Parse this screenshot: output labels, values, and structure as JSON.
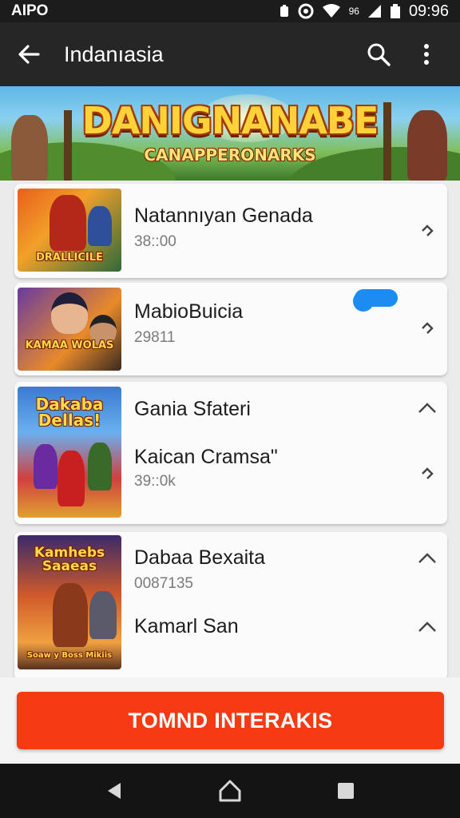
{
  "status_bar": {
    "carrier": "AIPO",
    "time": "09:96",
    "network_label": "96"
  },
  "app_bar": {
    "title": "Indanıasia"
  },
  "banner": {
    "title": "DANIGNANABE",
    "subtitle": "CANAPPERONARKS"
  },
  "list": {
    "items": [
      {
        "title": "Natannıyan Genada",
        "subtitle": "38::00",
        "thumb_label": "DRALLICILE",
        "icon": "chevron-right-icon"
      },
      {
        "title": "MabioBuicia",
        "subtitle": "29811",
        "thumb_label": "KAMAA WOLAS",
        "icon": "chevron-right-icon"
      },
      {
        "title": "Gania Sfateri",
        "subtitle": "",
        "thumb_label": "Dakaba Dellas!",
        "icon": "chevron-up-icon"
      },
      {
        "title": "Kaican Cramsa\"",
        "subtitle": "39::0k",
        "thumb_label": "",
        "icon": "chevron-right-icon"
      },
      {
        "title": "Dabaa Bexaita",
        "subtitle": "0087135",
        "thumb_label": "Kamhebs Saaeas",
        "thumb_footer": "Soaw y Boss Mikiis",
        "icon": "chevron-up-icon"
      },
      {
        "title": "Kamarl San",
        "subtitle": "",
        "thumb_label": "",
        "icon": "chevron-up-icon"
      }
    ]
  },
  "cta": {
    "label": "TOMND INTERAKIS"
  },
  "colors": {
    "accent": "#f53a14",
    "app_bar": "#262626",
    "pill": "#1c8cf2"
  }
}
